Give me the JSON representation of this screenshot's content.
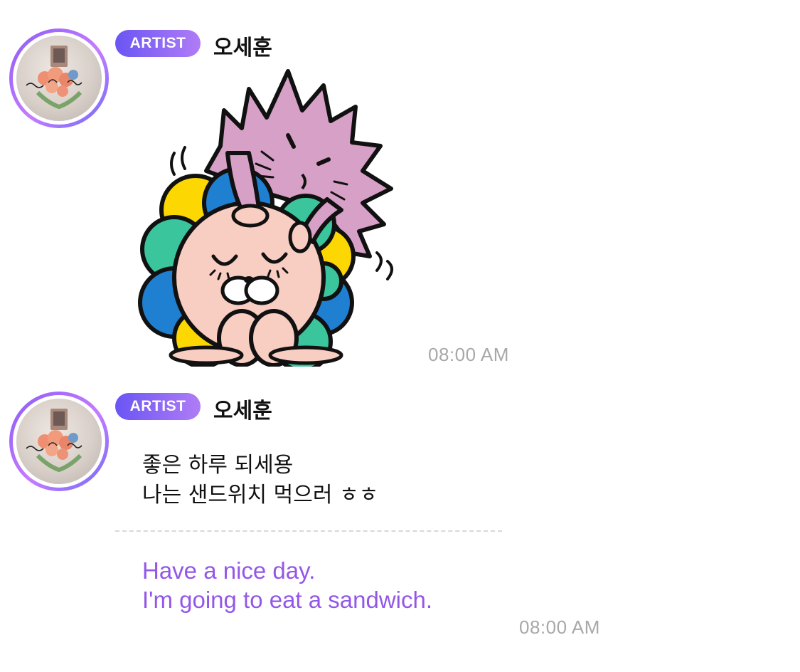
{
  "messages": [
    {
      "badge": "ARTIST",
      "sender": "오세훈",
      "type": "sticker",
      "sticker_icon": "lion-and-hedgehog-sticker",
      "time": "08:00 AM"
    },
    {
      "badge": "ARTIST",
      "sender": "오세훈",
      "type": "text",
      "lines": [
        "좋은 하루 되세용",
        "나는 샌드위치 먹으러 ㅎㅎ"
      ],
      "translation": [
        "Have a nice day.",
        "I'm going to eat a sandwich."
      ],
      "time": "08:00 AM"
    }
  ],
  "colors": {
    "badge_start": "#6a55f4",
    "badge_end": "#b07cf6",
    "translation": "#9357e8",
    "timestamp": "#a8a8a8"
  }
}
